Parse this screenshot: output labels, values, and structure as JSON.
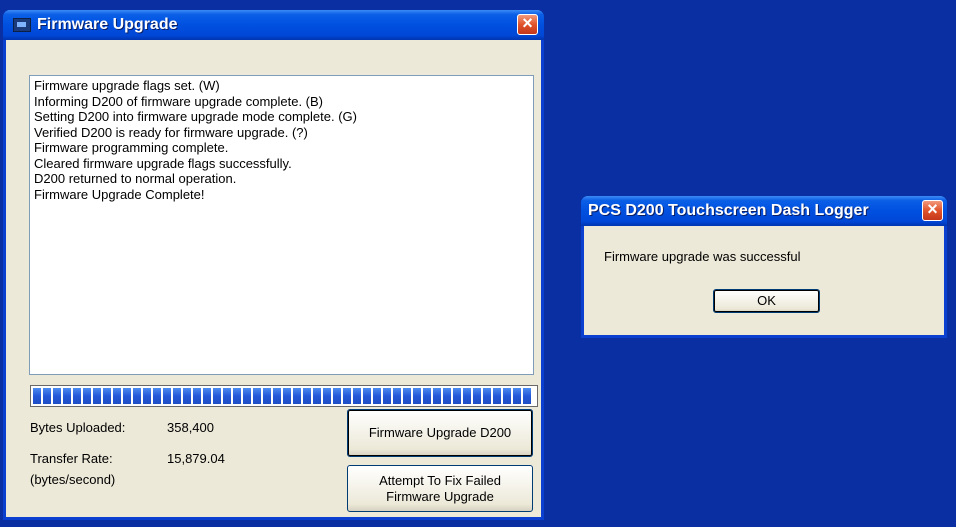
{
  "upgrade_window": {
    "title": "Firmware Upgrade",
    "close_glyph": "×",
    "log_lines": [
      "Firmware upgrade flags set. (W)",
      "Informing D200 of firmware upgrade complete. (B)",
      "Setting D200 into firmware upgrade mode complete. (G)",
      "Verified D200 is ready for firmware upgrade. (?)",
      "Firmware programming complete.",
      "Cleared firmware upgrade flags successfully.",
      "D200 returned to normal operation.",
      "Firmware Upgrade Complete!"
    ],
    "progress_fraction": 1.0,
    "bytes_uploaded_label": "Bytes Uploaded:",
    "bytes_uploaded_value": "358,400",
    "transfer_rate_label": "Transfer Rate:",
    "transfer_rate_value": "15,879.04",
    "transfer_rate_unit": "(bytes/second)",
    "upgrade_button": "Firmware Upgrade D200",
    "fix_button_line1": "Attempt To Fix Failed",
    "fix_button_line2": "Firmware Upgrade"
  },
  "message_dialog": {
    "title": "PCS D200 Touchscreen Dash Logger",
    "close_glyph": "×",
    "message": "Firmware upgrade was successful",
    "ok_button": "OK"
  },
  "colors": {
    "desktop": "#0a2fa3",
    "titlebar": "#0050e0",
    "window_face": "#ece9d8",
    "progress_fill": "#2358d8"
  },
  "icons": [
    "app-icon",
    "close-icon"
  ]
}
